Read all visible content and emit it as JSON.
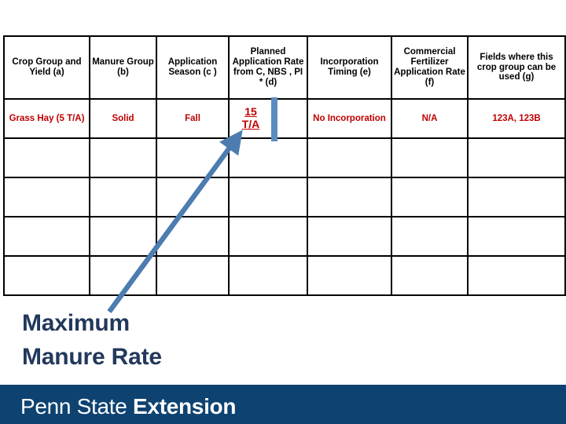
{
  "slide": {
    "table": {
      "headers": [
        "Crop Group and Yield (a)",
        "Manure Group (b)",
        "Application Season (c )",
        "Planned Application Rate from C, NBS , PI * (d)",
        "Incorporation Timing (e)",
        "Commercial Fertilizer Application Rate (f)",
        "Fields where this crop group can be used (g)"
      ],
      "rows": [
        {
          "crop_group": "Grass Hay (5 T/A)",
          "manure_group": "Solid",
          "application_season": "Fall",
          "planned_rate_value": "15",
          "planned_rate_unit": "T/A",
          "incorporation_timing": "No Incorporation",
          "commercial_fertilizer_rate": "N/A",
          "fields": "123A, 123B"
        },
        {
          "crop_group": "",
          "manure_group": "",
          "application_season": "",
          "planned_rate": "",
          "incorporation_timing": "",
          "commercial_fertilizer_rate": "",
          "fields": ""
        },
        {
          "crop_group": "",
          "manure_group": "",
          "application_season": "",
          "planned_rate": "",
          "incorporation_timing": "",
          "commercial_fertilizer_rate": "",
          "fields": ""
        },
        {
          "crop_group": "",
          "manure_group": "",
          "application_season": "",
          "planned_rate": "",
          "incorporation_timing": "",
          "commercial_fertilizer_rate": "",
          "fields": ""
        },
        {
          "crop_group": "",
          "manure_group": "",
          "application_season": "",
          "planned_rate": "",
          "incorporation_timing": "",
          "commercial_fertilizer_rate": "",
          "fields": ""
        }
      ]
    },
    "callout": {
      "line1": "Maximum",
      "line2": "Manure Rate"
    },
    "footer": {
      "brand_light": "Penn State",
      "brand_bold": "Extension"
    },
    "colors": {
      "table_text_red": "#C00000",
      "header_text": "#000000",
      "callout_navy": "#22385C",
      "arrow_blue": "#4C7CB0",
      "cursor_blue": "#5B8CC0",
      "footer_navy": "#0E4271",
      "grid_line": "#000000"
    }
  }
}
